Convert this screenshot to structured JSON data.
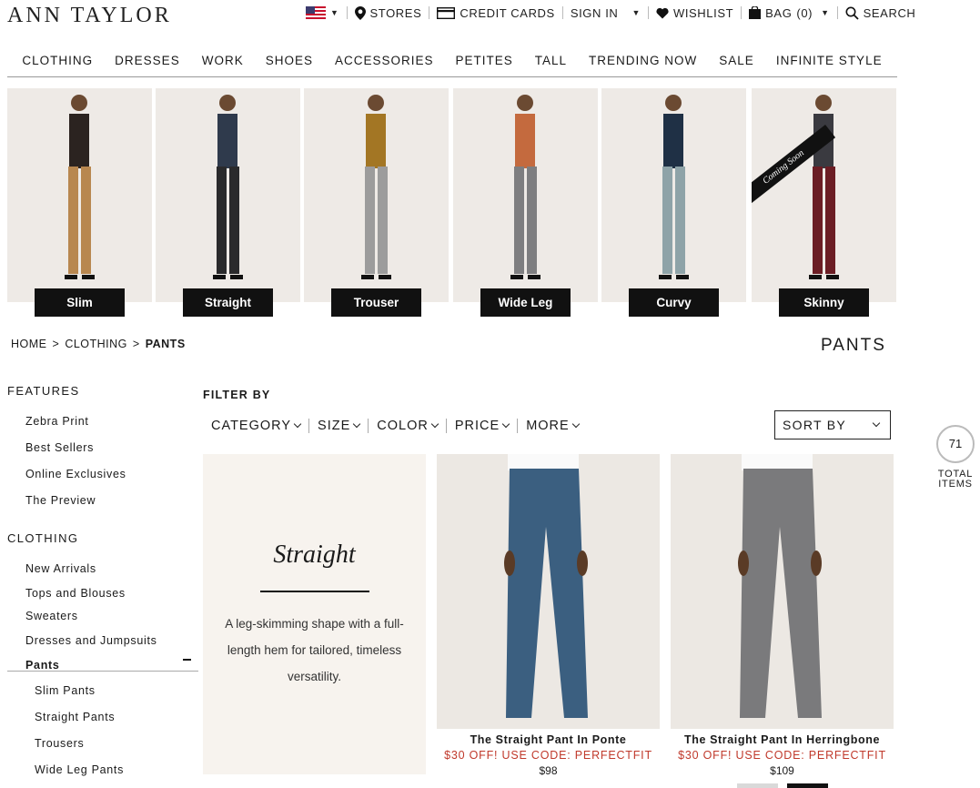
{
  "brand": {
    "logo": "ANN TAYLOR"
  },
  "utility": {
    "stores": "STORES",
    "credit_cards": "CREDIT CARDS",
    "sign_in": "SIGN IN",
    "wishlist": "WISHLIST",
    "bag": "BAG",
    "bag_count": "(0)",
    "search": "SEARCH"
  },
  "nav": [
    "CLOTHING",
    "DRESSES",
    "WORK",
    "SHOES",
    "ACCESSORIES",
    "PETITES",
    "TALL",
    "TRENDING NOW",
    "SALE",
    "INFINITE STYLE"
  ],
  "fits": [
    {
      "label": "Slim",
      "top": "#2b2320",
      "pant": "#b8874f"
    },
    {
      "label": "Straight",
      "top": "#2f3a4c",
      "pant": "#2a2a2c"
    },
    {
      "label": "Trouser",
      "top": "#a37624",
      "pant": "#9c9c9c"
    },
    {
      "label": "Wide Leg",
      "top": "#c46a3e",
      "pant": "#7e7e80"
    },
    {
      "label": "Curvy",
      "top": "#1f3045",
      "pant": "#8ea3a8"
    },
    {
      "label": "Skinny",
      "top": "#3a3a40",
      "pant": "#6b1d24",
      "badge": "Coming Soon"
    }
  ],
  "breadcrumb": {
    "home": "HOME",
    "sep": ">",
    "clothing": "CLOTHING",
    "current": "PANTS"
  },
  "page_title": "PANTS",
  "sidebar": {
    "features_header": "FEATURES",
    "features": [
      "Zebra Print",
      "Best Sellers",
      "Online Exclusives",
      "The Preview"
    ],
    "clothing_header": "CLOTHING",
    "clothing": [
      "New Arrivals",
      "Tops and Blouses",
      "Sweaters",
      "Dresses and Jumpsuits",
      "Pants"
    ],
    "pants_sub": [
      "Slim Pants",
      "Straight Pants",
      "Trousers",
      "Wide Leg Pants"
    ]
  },
  "filters": {
    "label": "FILTER BY",
    "items": [
      "CATEGORY",
      "SIZE",
      "COLOR",
      "PRICE",
      "MORE"
    ],
    "sort": "SORT BY"
  },
  "total": {
    "count": "71",
    "label": "TOTAL ITEMS"
  },
  "promo": {
    "title": "Straight",
    "desc": "A leg-skimming shape with a full-length hem for tailored, timeless versatility."
  },
  "products": [
    {
      "name": "The Straight Pant In Ponte",
      "promo": "$30 OFF! USE CODE: PERFECTFIT",
      "price": "$98",
      "color": "#3b5f80"
    },
    {
      "name": "The Straight Pant In Herringbone",
      "promo": "$30 OFF! USE CODE: PERFECTFIT",
      "price": "$109",
      "color": "#7a7a7c"
    }
  ],
  "colors": {
    "promo_red": "#c0392b",
    "swatch_light": "#d9d9d9",
    "swatch_dark": "#111111"
  }
}
